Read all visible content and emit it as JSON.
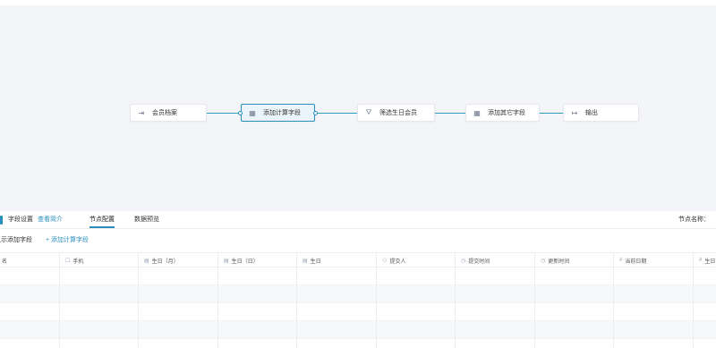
{
  "flow": {
    "nodes": [
      {
        "label": "会员档案",
        "icon": "⇥"
      },
      {
        "label": "添加计算字段",
        "icon": "▦"
      },
      {
        "label": "筛选生日会员",
        "icon": "⛛"
      },
      {
        "label": "添加其它字段",
        "icon": "▦"
      },
      {
        "label": "输出",
        "icon": "↦"
      }
    ]
  },
  "panel": {
    "title": "字段设置",
    "title_link": "查看简介",
    "tabs": [
      "节点配置",
      "数据预览"
    ],
    "node_name_label": "节点名称：",
    "toolbar": {
      "show_fields": "显示添加字段",
      "add_field": "+ 添加计算字段"
    },
    "columns": [
      {
        "label": "名",
        "icon": ""
      },
      {
        "label": "手机",
        "icon": "☐"
      },
      {
        "label": "生日（月）",
        "icon": "▤"
      },
      {
        "label": "生日（日）",
        "icon": "▤"
      },
      {
        "label": "生日",
        "icon": "▤"
      },
      {
        "label": "提交人",
        "icon": "⚇"
      },
      {
        "label": "提交时间",
        "icon": "◷"
      },
      {
        "label": "更新时间",
        "icon": "◷"
      },
      {
        "label": "当前日期",
        "icon": "#"
      },
      {
        "label": "生日",
        "icon": "#"
      }
    ]
  },
  "colors": {
    "accent": "#2a8fbd",
    "canvas_bg": "#f4f5f9"
  }
}
